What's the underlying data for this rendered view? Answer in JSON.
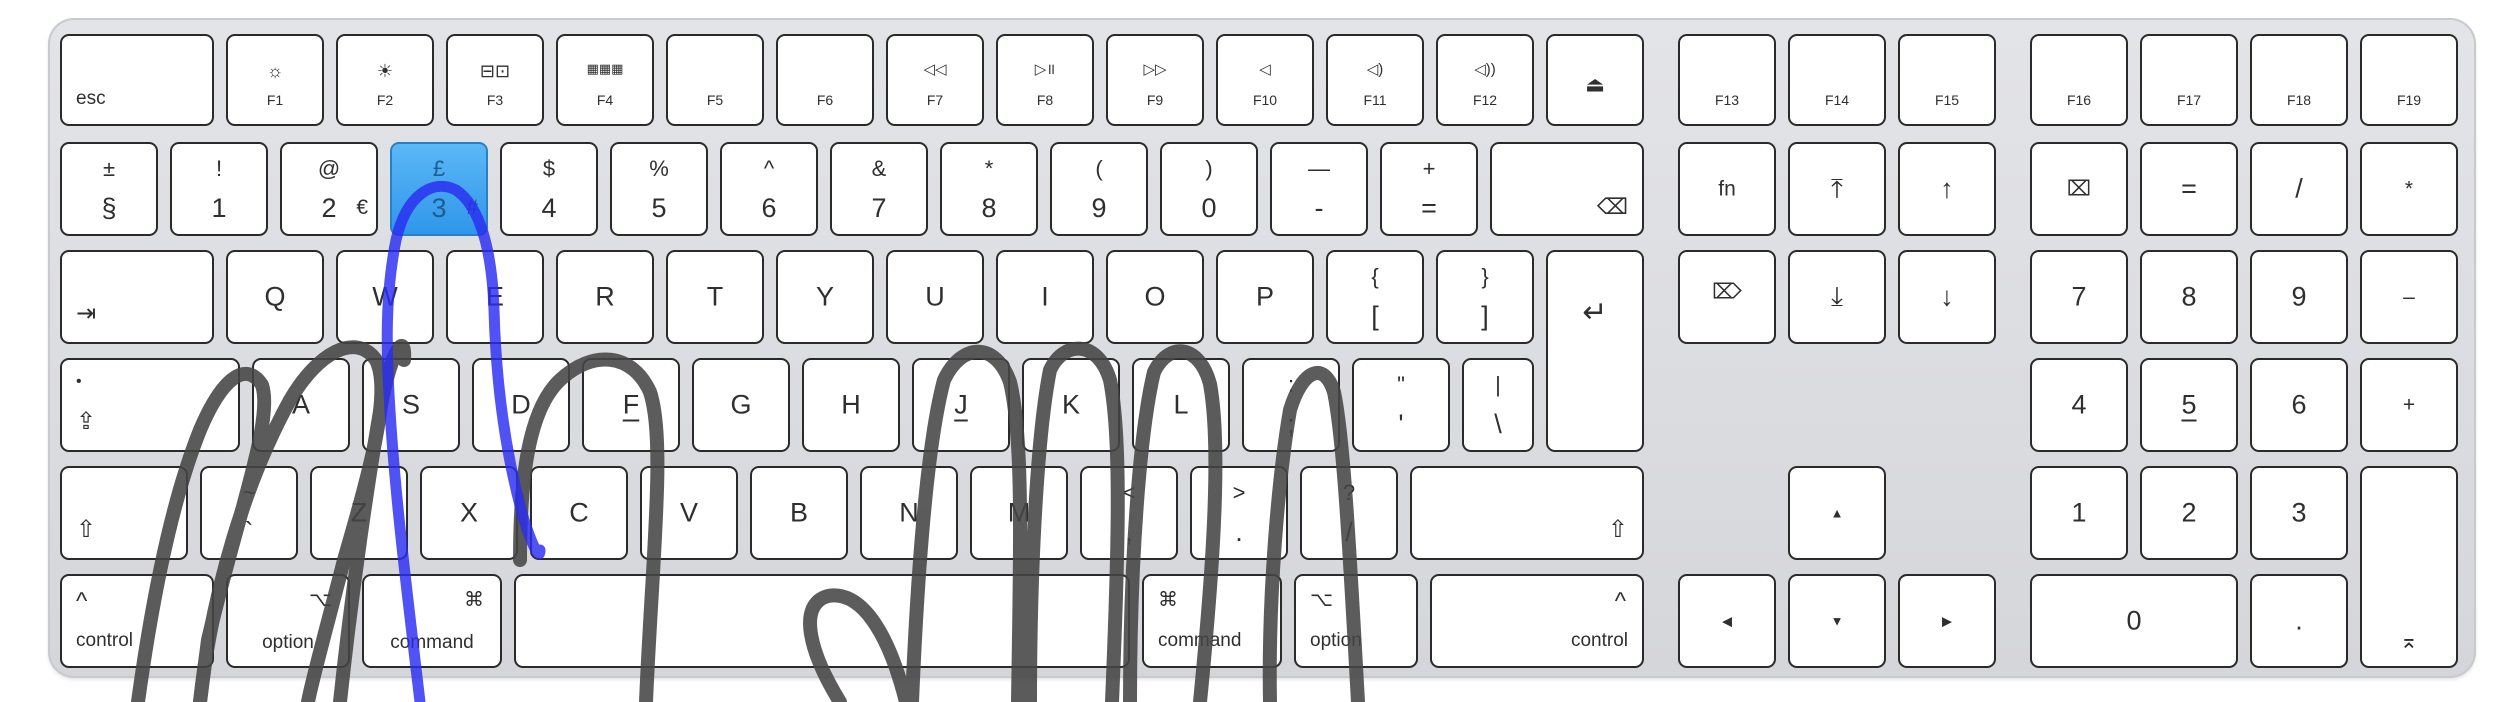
{
  "keyboard": {
    "colors": {
      "key": "#ffffff",
      "active_key": "#3fa2ef",
      "finger_ink": "#454545",
      "path_ink": "#2a2cf0"
    },
    "fn_row": [
      {
        "label": "esc"
      },
      {
        "label": "F1",
        "icon": "☼"
      },
      {
        "label": "F2",
        "icon": "☀"
      },
      {
        "label": "F3",
        "icon": "⊟⊡"
      },
      {
        "label": "F4",
        "icon": "▦▦▦"
      },
      {
        "label": "F5"
      },
      {
        "label": "F6"
      },
      {
        "label": "F7",
        "icon": "◁◁"
      },
      {
        "label": "F8",
        "icon": "▷॥"
      },
      {
        "label": "F9",
        "icon": "▷▷"
      },
      {
        "label": "F10",
        "icon": "◁"
      },
      {
        "label": "F11",
        "icon": "◁)"
      },
      {
        "label": "F12",
        "icon": "◁))"
      },
      {
        "icon": "⏏"
      },
      {
        "label": "F13"
      },
      {
        "label": "F14"
      },
      {
        "label": "F15"
      },
      {
        "label": "F16"
      },
      {
        "label": "F17"
      },
      {
        "label": "F18"
      },
      {
        "label": "F19"
      }
    ],
    "number_row": [
      {
        "top": "±",
        "bottom": "§"
      },
      {
        "top": "!",
        "bottom": "1"
      },
      {
        "top": "@",
        "bottom": "2",
        "alt": "€"
      },
      {
        "top": "£",
        "bottom": "3",
        "alt": "#"
      },
      {
        "top": "$",
        "bottom": "4"
      },
      {
        "top": "%",
        "bottom": "5"
      },
      {
        "top": "^",
        "bottom": "6"
      },
      {
        "top": "&",
        "bottom": "7"
      },
      {
        "top": "*",
        "bottom": "8"
      },
      {
        "top": "(",
        "bottom": "9"
      },
      {
        "top": ")",
        "bottom": "0"
      },
      {
        "top": "—",
        "bottom": "-"
      },
      {
        "top": "+",
        "bottom": "="
      },
      {
        "icon": "⌫"
      }
    ],
    "qwerty_row": [
      "Q",
      "W",
      "E",
      "R",
      "T",
      "Y",
      "U",
      "I",
      "O",
      "P"
    ],
    "qwerty_extra": [
      {
        "top": "{",
        "bottom": "["
      },
      {
        "top": "}",
        "bottom": "]"
      }
    ],
    "home_row": [
      "A",
      "S",
      "D",
      "F",
      "G",
      "H",
      "J",
      "K",
      "L"
    ],
    "home_extra": [
      {
        "top": ":",
        "bottom": ";"
      },
      {
        "top": "\"",
        "bottom": "'"
      },
      {
        "top": "|",
        "bottom": "\\"
      }
    ],
    "bottom_row": [
      "Z",
      "X",
      "C",
      "V",
      "B",
      "N",
      "M"
    ],
    "bottom_extra": [
      {
        "top": "~",
        "bottom": "`"
      },
      {
        "top": "<",
        "bottom": ","
      },
      {
        "top": ">",
        "bottom": "."
      },
      {
        "top": "?",
        "bottom": "/"
      }
    ],
    "modifiers": {
      "tab": "⇥",
      "return": "↵",
      "caps_dot": "•",
      "caps": "⇪",
      "shift": "⇧",
      "control": "control",
      "control_symbol": "^",
      "option": "option",
      "option_symbol": "⌥",
      "command": "command",
      "command_symbol": "⌘",
      "fn": "fn"
    },
    "nav": {
      "home": "⤒",
      "up_page": "↑",
      "fwd_delete": "⌦",
      "end": "⤓",
      "down_page": "↓",
      "arrow_up": "▲",
      "arrow_left": "◀",
      "arrow_down": "▼",
      "arrow_right": "▶"
    },
    "numpad": {
      "clear": "⌧",
      "equals": "=",
      "divide": "/",
      "multiply": "*",
      "seven": "7",
      "eight": "8",
      "nine": "9",
      "minus": "–",
      "four": "4",
      "five": "5",
      "six": "6",
      "plus": "+",
      "one": "1",
      "two": "2",
      "three": "3",
      "zero": "0",
      "dot": ".",
      "enter": "⌅"
    }
  }
}
